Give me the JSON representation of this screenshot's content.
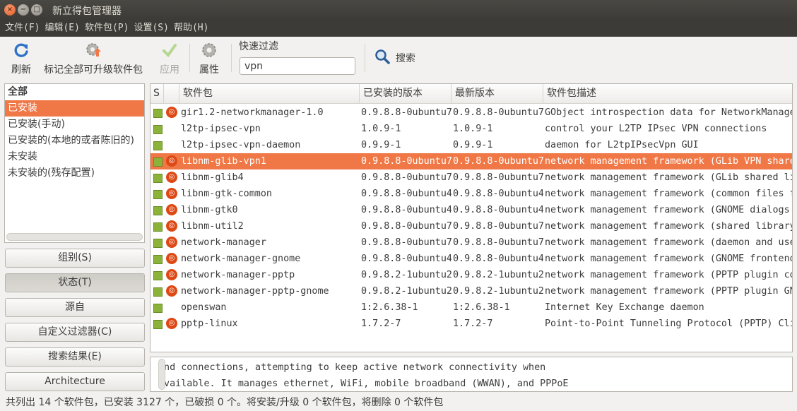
{
  "window": {
    "title": "新立得包管理器",
    "close": "×",
    "minimize": "−",
    "maximize": "□"
  },
  "menu": [
    "文件(F)",
    "编辑(E)",
    "软件包(P)",
    "设置(S)",
    "帮助(H)"
  ],
  "toolbar": {
    "refresh": "刷新",
    "mark_all_upgrades": "标记全部可升级软件包",
    "apply": "应用",
    "properties": "属性",
    "quick_filter_label": "快速过滤",
    "quick_filter_value": "vpn",
    "search": "搜索"
  },
  "sidebar": {
    "items": [
      "全部",
      "已安装",
      "已安装(手动)",
      "已安装的(本地的或者陈旧的)",
      "未安装",
      "未安装的(残存配置)"
    ],
    "selected": 1,
    "buttons": [
      "组别(S)",
      "状态(T)",
      "源自",
      "自定义过滤器(C)",
      "搜索结果(E)",
      "Architecture"
    ],
    "active_button": 1
  },
  "table": {
    "columns": [
      "S",
      "",
      "软件包",
      "已安装的版本",
      "最新版本",
      "软件包描述"
    ],
    "rows": [
      {
        "name": "gir1.2-networkmanager-1.0",
        "installed": "0.9.8.8-0ubuntu7",
        "latest": "0.9.8.8-0ubuntu7",
        "desc": "GObject introspection data for NetworkManager",
        "ubuntu": true
      },
      {
        "name": "l2tp-ipsec-vpn",
        "installed": "1.0.9-1",
        "latest": "1.0.9-1",
        "desc": "control your L2TP IPsec VPN connections",
        "ubuntu": false
      },
      {
        "name": "l2tp-ipsec-vpn-daemon",
        "installed": "0.9.9-1",
        "latest": "0.9.9-1",
        "desc": "daemon for L2tpIPsecVpn GUI",
        "ubuntu": false
      },
      {
        "name": "libnm-glib-vpn1",
        "installed": "0.9.8.8-0ubuntu7",
        "latest": "0.9.8.8-0ubuntu7",
        "desc": "network management framework (GLib VPN shared",
        "ubuntu": true
      },
      {
        "name": "libnm-glib4",
        "installed": "0.9.8.8-0ubuntu7",
        "latest": "0.9.8.8-0ubuntu7",
        "desc": "network management framework (GLib shared li",
        "ubuntu": true
      },
      {
        "name": "libnm-gtk-common",
        "installed": "0.9.8.8-0ubuntu4",
        "latest": "0.9.8.8-0ubuntu4",
        "desc": "network management framework (common files f",
        "ubuntu": true
      },
      {
        "name": "libnm-gtk0",
        "installed": "0.9.8.8-0ubuntu4",
        "latest": "0.9.8.8-0ubuntu4",
        "desc": "network management framework (GNOME dialogs",
        "ubuntu": true
      },
      {
        "name": "libnm-util2",
        "installed": "0.9.8.8-0ubuntu7",
        "latest": "0.9.8.8-0ubuntu7",
        "desc": "network management framework (shared library",
        "ubuntu": true
      },
      {
        "name": "network-manager",
        "installed": "0.9.8.8-0ubuntu7",
        "latest": "0.9.8.8-0ubuntu7",
        "desc": "network management framework (daemon and use",
        "ubuntu": true
      },
      {
        "name": "network-manager-gnome",
        "installed": "0.9.8.8-0ubuntu4",
        "latest": "0.9.8.8-0ubuntu4",
        "desc": "network management framework (GNOME frontend",
        "ubuntu": true
      },
      {
        "name": "network-manager-pptp",
        "installed": "0.9.8.2-1ubuntu2",
        "latest": "0.9.8.2-1ubuntu2",
        "desc": "network management framework (PPTP plugin co",
        "ubuntu": true
      },
      {
        "name": "network-manager-pptp-gnome",
        "installed": "0.9.8.2-1ubuntu2",
        "latest": "0.9.8.2-1ubuntu2",
        "desc": "network management framework (PPTP plugin GN",
        "ubuntu": true
      },
      {
        "name": "openswan",
        "installed": "1:2.6.38-1",
        "latest": "1:2.6.38-1",
        "desc": "Internet Key Exchange daemon",
        "ubuntu": false
      },
      {
        "name": "pptp-linux",
        "installed": "1.7.2-7",
        "latest": "1.7.2-7",
        "desc": "Point-to-Point Tunneling Protocol (PPTP) Cli",
        "ubuntu": true
      }
    ],
    "selected_row": 3
  },
  "description": [
    "and connections, attempting to keep active network connectivity when",
    "available. It manages ethernet, WiFi, mobile broadband (WWAN), and PPPoE"
  ],
  "status": "共列出 14 个软件包，已安装 3127 个，已破损 0 个。将安装/升级 0 个软件包，将删除 0 个软件包",
  "colors": {
    "accent": "#f07746",
    "titlebar": "#3c3b37",
    "installed_box": "#8bb33a",
    "ubuntu": "#dd4814"
  }
}
